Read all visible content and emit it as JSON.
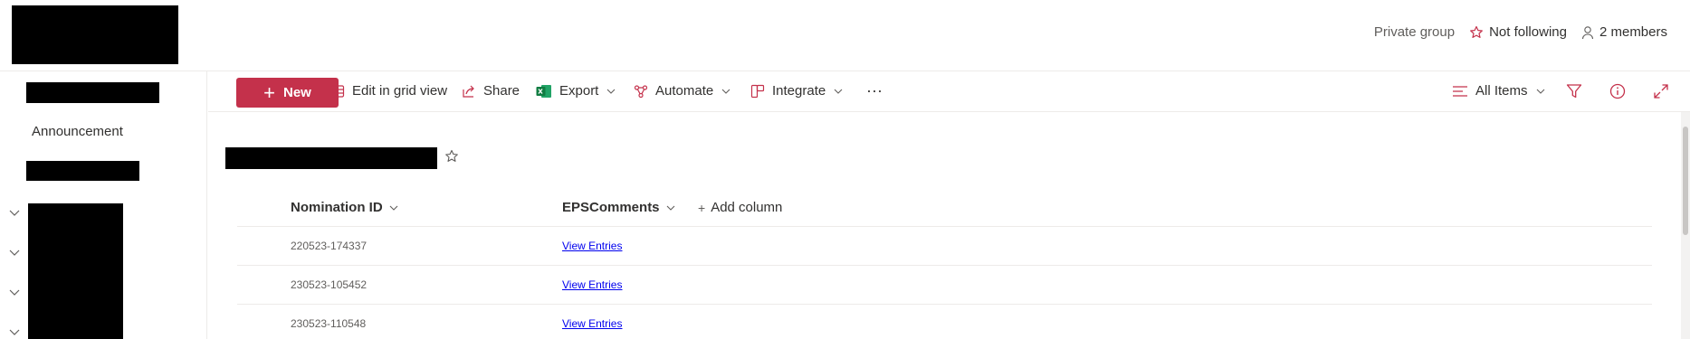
{
  "header": {
    "privacy": "Private group",
    "follow_label": "Not following",
    "members_label": "2 members"
  },
  "leftnav": {
    "items": [
      {
        "label": "Announcement"
      }
    ]
  },
  "commandbar": {
    "new_label": "New",
    "edit_grid_label": "Edit in grid view",
    "share_label": "Share",
    "export_label": "Export",
    "automate_label": "Automate",
    "integrate_label": "Integrate",
    "more_label": "···",
    "view_label": "All Items"
  },
  "list": {
    "columns": [
      {
        "label": "Nomination ID"
      },
      {
        "label": "EPSComments"
      },
      {
        "label": "Add column"
      }
    ],
    "rows": [
      {
        "id": "220523-174337",
        "comments": "View Entries"
      },
      {
        "id": "230523-105452",
        "comments": "View Entries"
      },
      {
        "id": "230523-110548",
        "comments": "View Entries"
      }
    ]
  },
  "colors": {
    "accent": "#c4314b",
    "link": "#0000ee"
  }
}
